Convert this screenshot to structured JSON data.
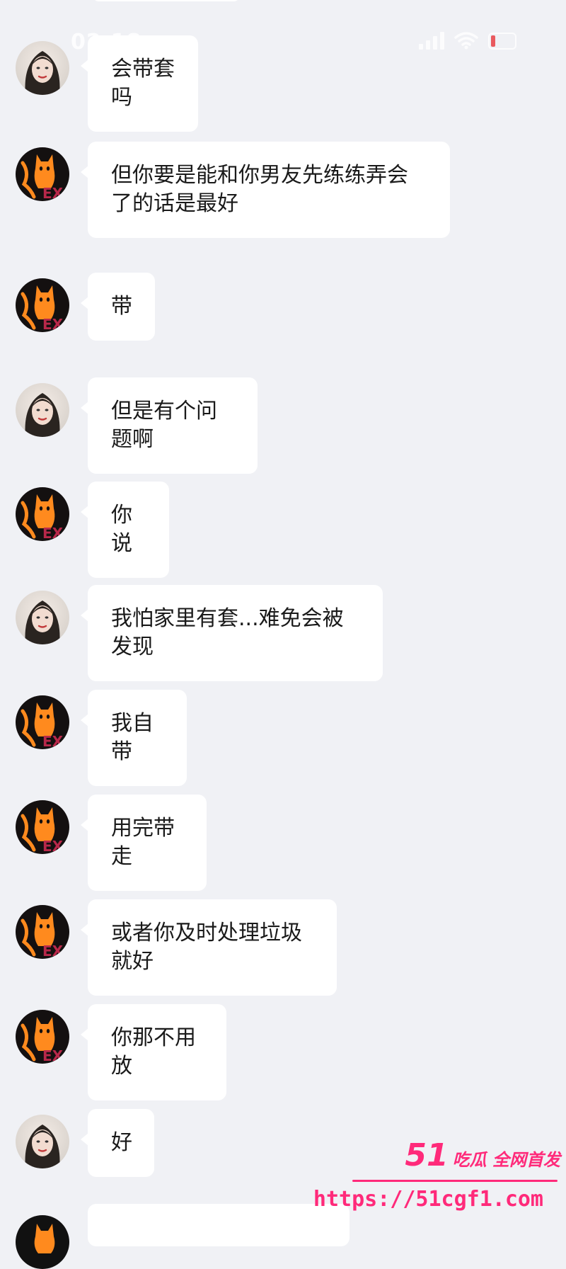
{
  "status_bar": {
    "time": "02:18"
  },
  "messages": [
    {
      "sender": "girl",
      "text": "会带套吗"
    },
    {
      "sender": "cat",
      "text": "但你要是能和你男友先练练弄会了的话是最好"
    },
    {
      "sender": "cat",
      "text": "带"
    },
    {
      "sender": "girl",
      "text": "但是有个问题啊"
    },
    {
      "sender": "cat",
      "text": "你说"
    },
    {
      "sender": "girl",
      "text": "我怕家里有套...难免会被发现"
    },
    {
      "sender": "cat",
      "text": "我自带"
    },
    {
      "sender": "cat",
      "text": "用完带走"
    },
    {
      "sender": "cat",
      "text": "或者你及时处理垃圾就好"
    },
    {
      "sender": "cat",
      "text": "你那不用放"
    },
    {
      "sender": "girl",
      "text": "好"
    }
  ],
  "watermark": {
    "number": "51",
    "tagline": "吃瓜 全网首发",
    "url": "https://51cgf1.com",
    "color": "#ff2a7a"
  },
  "colors": {
    "background": "#f0f1f5",
    "bubble": "#ffffff",
    "text": "#1a1a1a"
  }
}
